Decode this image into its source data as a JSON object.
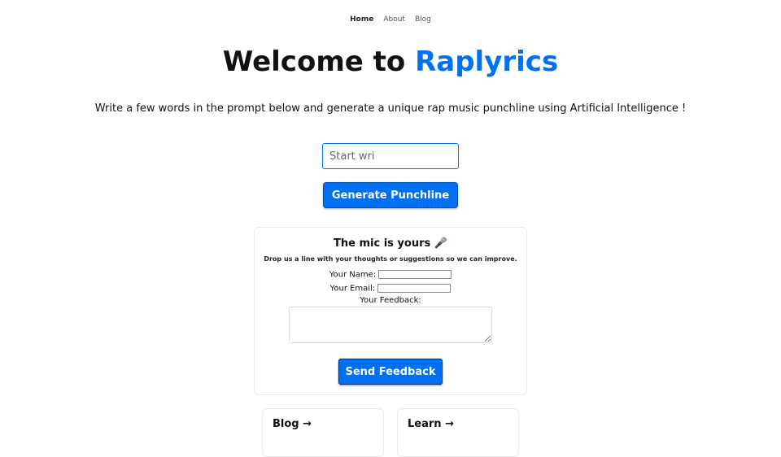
{
  "nav": {
    "items": [
      {
        "label": "Home",
        "active": true
      },
      {
        "label": "About",
        "active": false
      },
      {
        "label": "Blog",
        "active": false
      }
    ]
  },
  "hero": {
    "title_prefix": "Welcome to ",
    "title_brand": "Raplyrics",
    "description": "Write a few words in the prompt below and generate a unique rap music punchline using Artificial Intelligence !"
  },
  "prompt": {
    "placeholder": "Start wri",
    "value": ""
  },
  "generate_button": {
    "label": "Generate Punchline"
  },
  "feedback": {
    "title": "The mic is yours 🎤",
    "description": "Drop us a line with your thoughts or suggestions so we can improve.",
    "name_label": "Your Name:",
    "name_value": "",
    "email_label": "Your Email:",
    "email_value": "",
    "feedback_label": "Your Feedback:",
    "feedback_value": "",
    "send_label": "Send Feedback"
  },
  "cards": [
    {
      "label": "Blog →"
    },
    {
      "label": "Learn →"
    }
  ],
  "colors": {
    "brand": "#0070f3",
    "button_bg": "#0070f3",
    "button_text": "#ffffff"
  }
}
